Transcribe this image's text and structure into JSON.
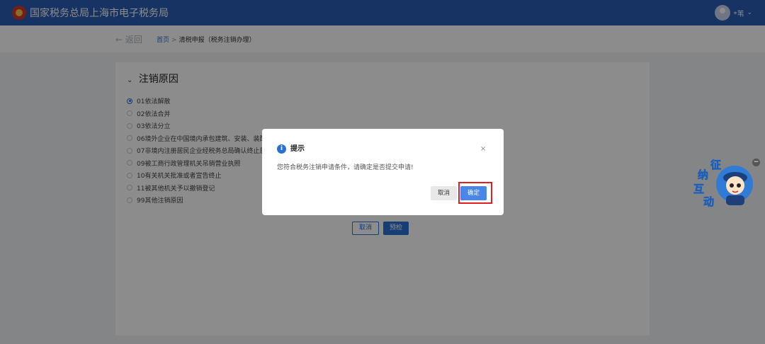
{
  "header": {
    "title": "国家税务总局上海市电子税务局",
    "user_name": "*苇"
  },
  "breadcrumb": {
    "back_label": "返回",
    "home": "首页",
    "separator": ">",
    "current": "清税申报（税务注销办理）"
  },
  "section": {
    "title": "注销原因",
    "reasons": [
      {
        "label": "01依法解散",
        "selected": true
      },
      {
        "label": "02依法合并",
        "selected": false
      },
      {
        "label": "03依法分立",
        "selected": false
      },
      {
        "label": "06境外企业在中国境内承包建筑、安装、装配",
        "selected": false
      },
      {
        "label": "07非境内注册居民企业经税务总局确认终止居",
        "selected": false
      },
      {
        "label": "09被工商行政管理机关吊销营业执照",
        "selected": false
      },
      {
        "label": "10有关机关批准或者宣告终止",
        "selected": false
      },
      {
        "label": "11被其他机关予以撤销登记",
        "selected": false
      },
      {
        "label": "99其他注销原因",
        "selected": false
      }
    ],
    "cancel_label": "取消",
    "precheck_label": "预检"
  },
  "dialog": {
    "title": "提示",
    "message": "您符合税务注销申请条件，请确定是否提交申请!",
    "cancel_label": "取消",
    "ok_label": "确定",
    "close_icon": "×",
    "info_icon": "i"
  },
  "mascot": {
    "chars": [
      "征",
      "纳",
      "互",
      "动"
    ],
    "collapse_icon": "−"
  },
  "colors": {
    "brand": "#2a5db4",
    "accent": "#2a6fd6",
    "highlight": "#e02020"
  }
}
